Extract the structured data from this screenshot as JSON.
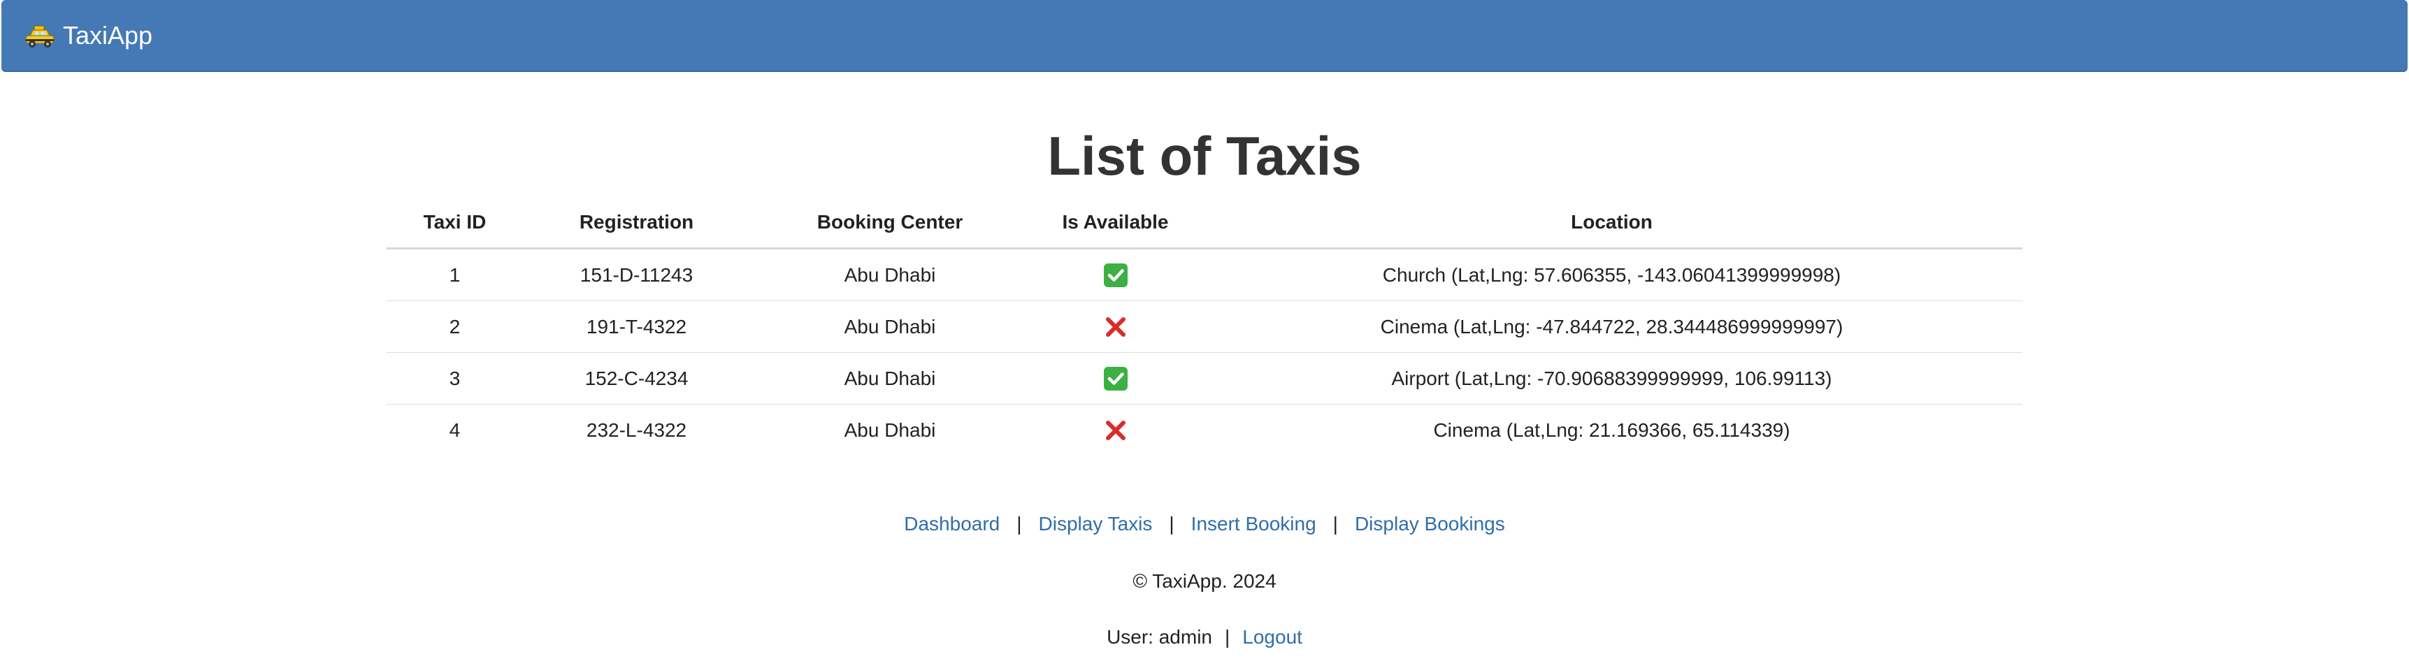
{
  "nav": {
    "brand": "TaxiApp",
    "brand_icon": "taxi-icon",
    "background_color": "#4479b5"
  },
  "page": {
    "title": "List of Taxis"
  },
  "table": {
    "headers": [
      "Taxi ID",
      "Registration",
      "Booking Center",
      "Is Available",
      "Location"
    ],
    "rows": [
      {
        "id": "1",
        "registration": "151-D-11243",
        "center": "Abu Dhabi",
        "available": true,
        "location": "Church (Lat,Lng: 57.606355, -143.06041399999998)"
      },
      {
        "id": "2",
        "registration": "191-T-4322",
        "center": "Abu Dhabi",
        "available": false,
        "location": "Cinema (Lat,Lng: -47.844722, 28.344486999999997)"
      },
      {
        "id": "3",
        "registration": "152-C-4234",
        "center": "Abu Dhabi",
        "available": true,
        "location": "Airport (Lat,Lng: -70.90688399999999, 106.99113)"
      },
      {
        "id": "4",
        "registration": "232-L-4322",
        "center": "Abu Dhabi",
        "available": false,
        "location": "Cinema (Lat,Lng: 21.169366, 65.114339)"
      }
    ]
  },
  "footer": {
    "links": [
      "Dashboard",
      "Display Taxis",
      "Insert Booking",
      "Display Bookings"
    ],
    "separator": "|",
    "copyright": "© TaxiApp. 2024",
    "user_text": "User: admin",
    "logout": "Logout"
  },
  "colors": {
    "link": "#2f6ea9",
    "available": "#3cb043",
    "unavailable": "#d92c2c"
  }
}
